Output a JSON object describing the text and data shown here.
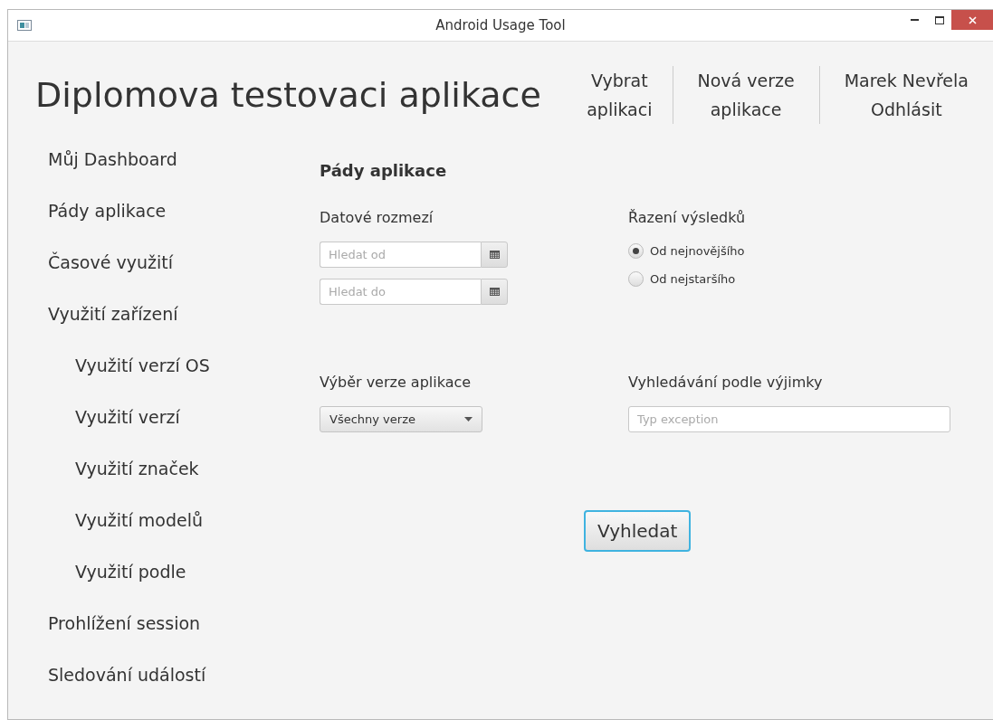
{
  "window": {
    "title": "Android Usage Tool"
  },
  "header": {
    "title": "Diplomova testovaci aplikace",
    "nav": [
      {
        "lines": [
          "Vybrat",
          "aplikaci"
        ]
      },
      {
        "lines": [
          "Nová verze",
          "aplikace"
        ]
      },
      {
        "lines": [
          "Marek Nevřela",
          "Odhlásit"
        ]
      }
    ]
  },
  "sidebar": {
    "items": [
      {
        "label": "Můj Dashboard"
      },
      {
        "label": "Pády aplikace"
      },
      {
        "label": "Časové využití"
      },
      {
        "label": "Využití zařízení",
        "children": [
          {
            "label": "Využití verzí OS"
          },
          {
            "label": "Využití verzí"
          },
          {
            "label": "Využití značek"
          },
          {
            "label": "Využití modelů"
          },
          {
            "label": "Využití podle"
          }
        ]
      },
      {
        "label": "Prohlížení session"
      },
      {
        "label": "Sledování událostí"
      }
    ]
  },
  "content": {
    "heading": "Pády aplikace",
    "date_range": {
      "label": "Datové rozmezí",
      "fields": [
        {
          "placeholder": "Hledat od"
        },
        {
          "placeholder": "Hledat do"
        }
      ]
    },
    "sort": {
      "label": "Řazení výsledků",
      "options": [
        {
          "label": "Od nejnovějšího",
          "selected": true
        },
        {
          "label": "Od nejstaršího",
          "selected": false
        }
      ]
    },
    "version": {
      "label": "Výběr verze aplikace",
      "value": "Všechny verze"
    },
    "exception": {
      "label": "Vyhledávání podle výjimky",
      "placeholder": "Typ exception"
    },
    "search_button": "Vyhledat"
  }
}
